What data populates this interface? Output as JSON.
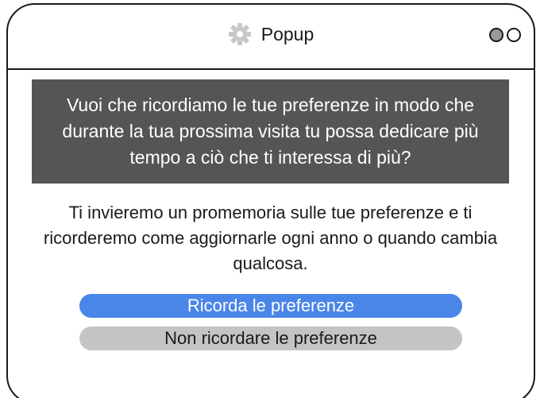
{
  "window": {
    "title": "Popup",
    "title_icon": "gear-icon",
    "controls": [
      "circle-filled",
      "circle-empty"
    ]
  },
  "popup": {
    "question": "Vuoi che ricordiamo le tue preferenze in modo che durante la tua prossima visita tu possa dedicare più tempo a ciò che ti interessa di più?",
    "info": "Ti invieremo un promemoria sulle tue preferenze e ti ricorderemo come aggiornarle ogni anno o quando cambia qualcosa.",
    "primary_button": "Ricorda le preferenze",
    "secondary_button": "Non ricordare le preferenze"
  },
  "colors": {
    "banner_bg": "#555555",
    "primary": "#4a86e8",
    "secondary": "#c4c4c4",
    "control_filled": "#9a9a9a"
  }
}
